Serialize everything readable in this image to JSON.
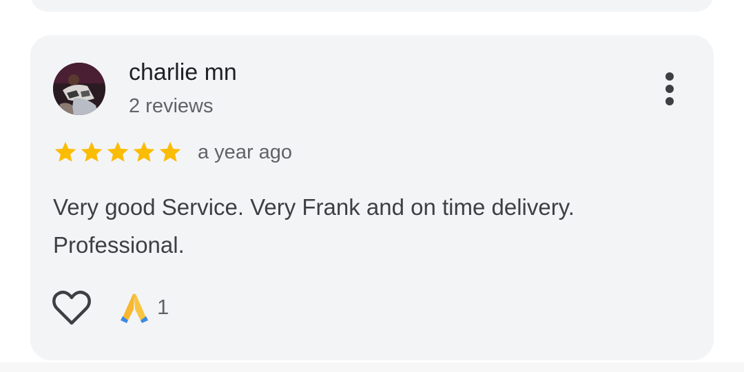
{
  "review": {
    "author_name": "charlie mn",
    "review_count": "2 reviews",
    "rating": 5,
    "date": "a year ago",
    "text": "Very good Service. Very Frank and on time delivery. Professional.",
    "reaction": {
      "icon": "folded-hands-icon",
      "count": "1"
    },
    "like_icon": "heart-outline-icon",
    "menu_icon": "more-vert-icon"
  },
  "colors": {
    "card_background": "#f3f4f6",
    "star": "#fbbc04",
    "primary_text": "#202124",
    "secondary_text": "#5f6368"
  }
}
